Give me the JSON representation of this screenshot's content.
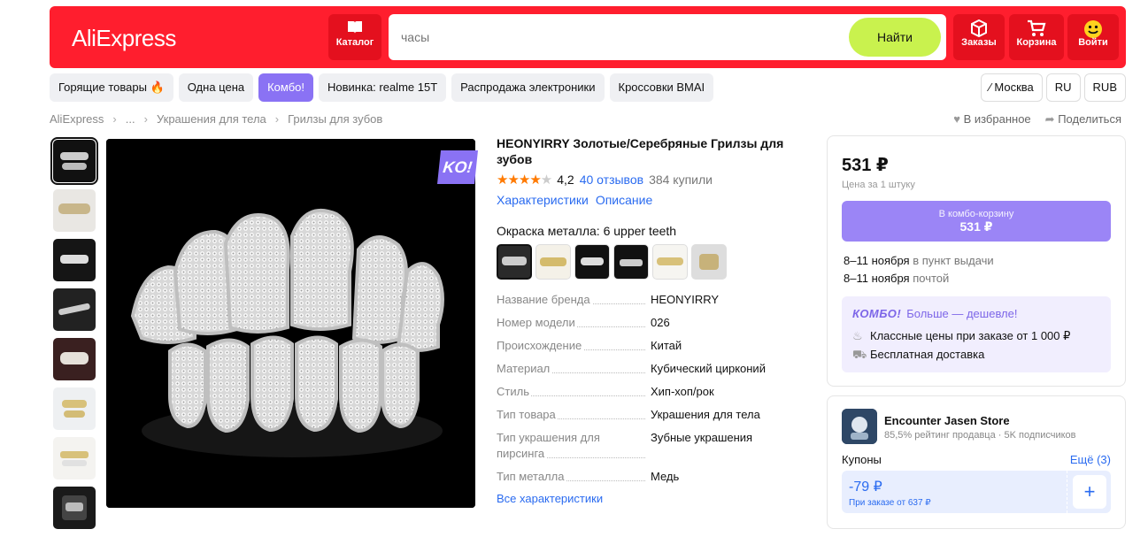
{
  "header": {
    "logo": "AliExpress",
    "catalog_label": "Каталог",
    "search_placeholder": "часы",
    "search_button": "Найти",
    "orders_label": "Заказы",
    "cart_label": "Корзина",
    "login_label": "Войти"
  },
  "chips": [
    {
      "label": "Горящие товары 🔥"
    },
    {
      "label": "Одна цена"
    },
    {
      "label": "Комбо!"
    },
    {
      "label": "Новинка: realme 15T"
    },
    {
      "label": "Распродажа электроники"
    },
    {
      "label": "Кроссовки BMAI"
    }
  ],
  "region": {
    "city": "Москва",
    "lang": "RU",
    "currency": "RUB"
  },
  "breadcrumb": [
    "AliExpress",
    "...",
    "Украшения для тела",
    "Грилзы для зубов"
  ],
  "actions": {
    "favorite": "В избранное",
    "share": "Поделиться"
  },
  "gallery": {
    "badge": "KO!"
  },
  "product": {
    "title": "HEONYIRRY Золотые/Серебряные Грилзы для зубов",
    "rating": "4,2",
    "reviews": "40 отзывов",
    "bought": "384 купили",
    "tab_specs": "Характеристики",
    "tab_desc": "Описание",
    "variant_label": "Окраска металла: 6 upper teeth",
    "specs": [
      {
        "k": "Название бренда",
        "v": "HEONYIRRY"
      },
      {
        "k": "Номер модели",
        "v": "026"
      },
      {
        "k": "Происхождение",
        "v": "Китай"
      },
      {
        "k": "Материал",
        "v": "Кубический цирконий"
      },
      {
        "k": "Стиль",
        "v": "Хип-хоп/рок"
      },
      {
        "k": "Тип товара",
        "v": "Украшения для тела"
      },
      {
        "k": "Тип украшения для пирсинга",
        "v": "Зубные украшения"
      },
      {
        "k": "Тип металла",
        "v": "Медь"
      }
    ],
    "all_specs": "Все характеристики"
  },
  "buy": {
    "price": "531 ₽",
    "unit": "Цена за 1 штуку",
    "combo_btn_top": "В комбо-корзину",
    "combo_btn_price": "531 ₽",
    "delivery1_date": "8–11 ноября",
    "delivery1_method": "в пункт выдачи",
    "delivery2_date": "8–11 ноября",
    "delivery2_method": "почтой",
    "combo_logo": "КОМБО!",
    "combo_head": "Больше — дешевле!",
    "combo_line1": "Классные цены при заказе от 1 000 ₽",
    "combo_line2": "Бесплатная доставка"
  },
  "store": {
    "name": "Encounter Jasen Store",
    "meta": "85,5% рейтинг продавца  ·  5K подписчиков",
    "coupons_label": "Купоны",
    "more": "Ещё (3)",
    "coupon_value": "-79 ₽",
    "coupon_note": "При заказе от 637 ₽"
  },
  "colors": {
    "brand_red": "#ff1e2e",
    "combo_purple": "#8a72f4",
    "search_green": "#c9f24e",
    "link_blue": "#2a6bf0"
  }
}
